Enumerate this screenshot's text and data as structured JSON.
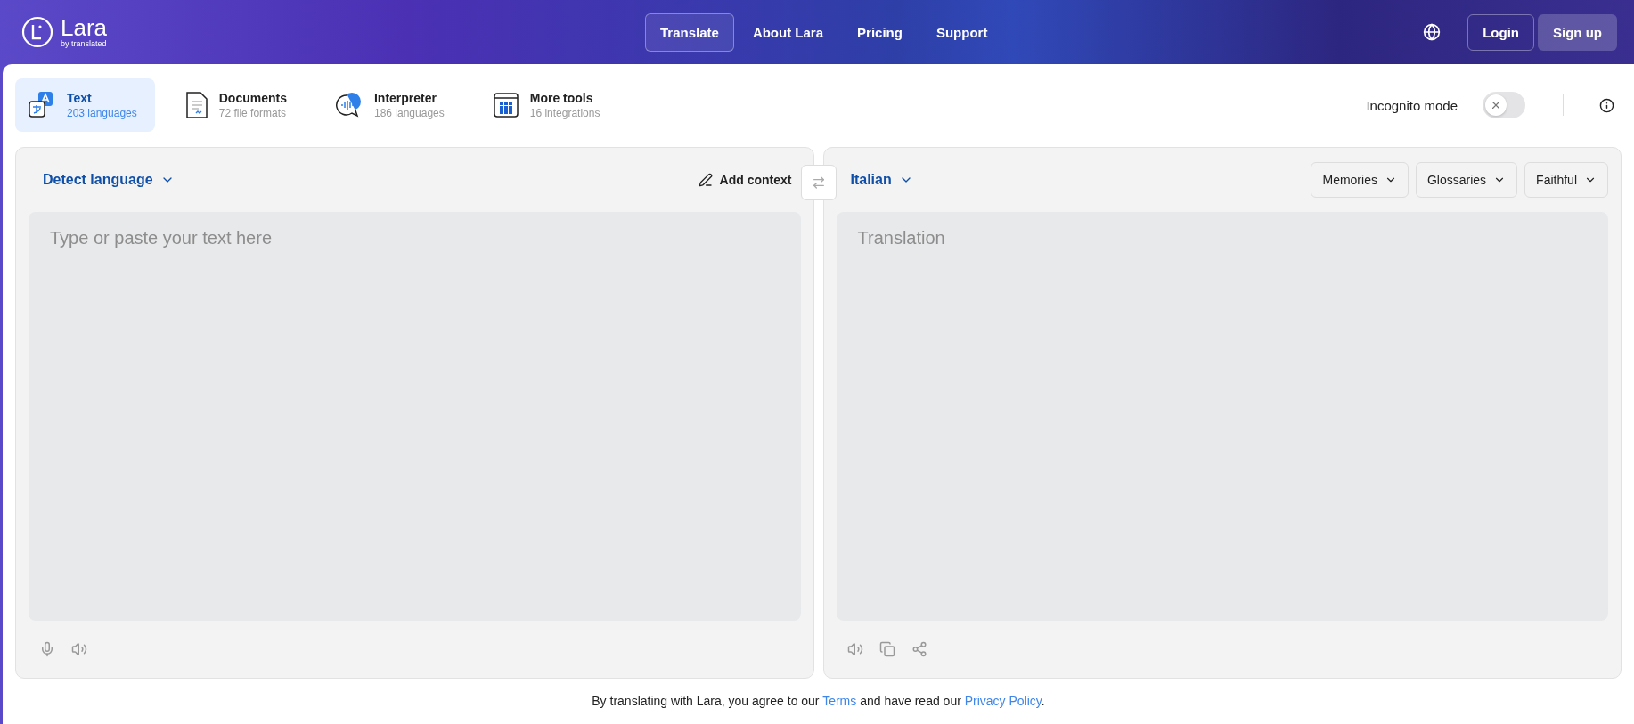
{
  "brand": {
    "name": "Lara",
    "tagline": "by translated"
  },
  "nav": [
    {
      "label": "Translate",
      "selected": true
    },
    {
      "label": "About Lara",
      "selected": false
    },
    {
      "label": "Pricing",
      "selected": false
    },
    {
      "label": "Support",
      "selected": false
    }
  ],
  "account": {
    "login": "Login",
    "signup": "Sign up"
  },
  "modes": [
    {
      "kind": "text",
      "title": "Text",
      "subtitle": "203 languages",
      "selected": true
    },
    {
      "kind": "documents",
      "title": "Documents",
      "subtitle": "72 file formats",
      "selected": false
    },
    {
      "kind": "interpreter",
      "title": "Interpreter",
      "subtitle": "186 languages",
      "selected": false
    },
    {
      "kind": "tools",
      "title": "More tools",
      "subtitle": "16 integrations",
      "selected": false
    }
  ],
  "incognito": {
    "label": "Incognito mode",
    "on": false
  },
  "source": {
    "language": "Detect language",
    "add_context": "Add context",
    "placeholder": "Type or paste your text here"
  },
  "target": {
    "language": "Italian",
    "options": [
      "Memories",
      "Glossaries",
      "Faithful"
    ],
    "placeholder": "Translation"
  },
  "footer": {
    "before": "By translating with Lara, you agree to our ",
    "terms": "Terms",
    "middle": " and have read our ",
    "privacy": "Privacy Policy",
    "after": "."
  }
}
